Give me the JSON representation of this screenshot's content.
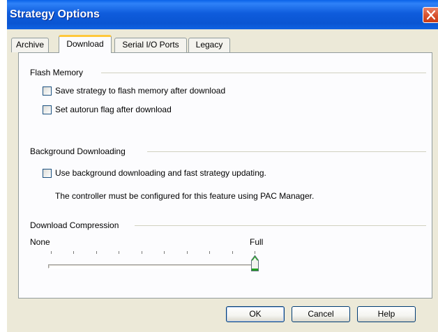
{
  "window": {
    "title": "Strategy Options"
  },
  "tabs": [
    {
      "label": "Archive",
      "active": false
    },
    {
      "label": "Download",
      "active": true
    },
    {
      "label": "Serial I/O Ports",
      "active": false
    },
    {
      "label": "Legacy",
      "active": false
    }
  ],
  "flash_memory": {
    "label": "Flash Memory",
    "options": [
      {
        "label": "Save strategy to flash memory after download",
        "checked": false
      },
      {
        "label": "Set autorun flag after download",
        "checked": false
      }
    ]
  },
  "background_downloading": {
    "label": "Background Downloading",
    "option": {
      "label": "Use background downloading and fast strategy updating.",
      "checked": false
    },
    "note": "The controller must be configured for this feature using PAC Manager."
  },
  "download_compression": {
    "label": "Download Compression",
    "min_label": "None",
    "max_label": "Full",
    "level": 1.0,
    "tick_count": 10
  },
  "buttons": {
    "ok": "OK",
    "cancel": "Cancel",
    "help": "Help"
  },
  "colors": {
    "titlebar": "#0a55d2",
    "close_button": "#d8502c",
    "dialog_bg": "#ece9d8",
    "active_tab_highlight": "#ffc83c",
    "slider_thumb_accent": "#21a121"
  }
}
